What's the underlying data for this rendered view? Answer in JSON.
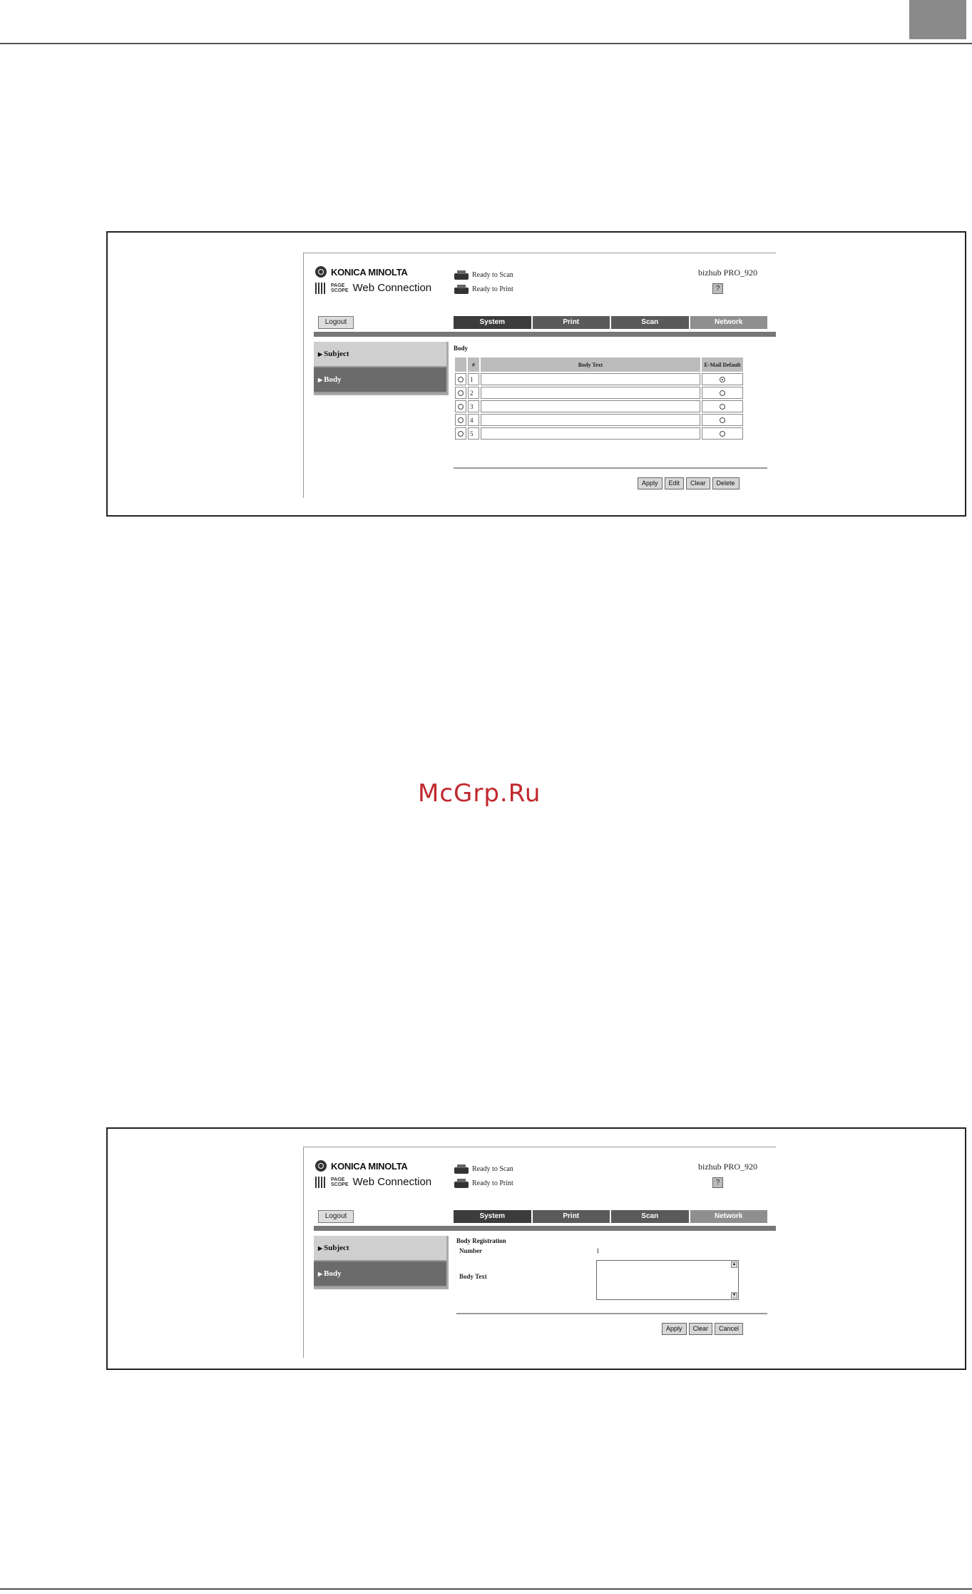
{
  "watermark": "McGrp.Ru",
  "screen1": {
    "brand": {
      "maker": "KONICA MINOLTA",
      "page_scope": "PAGE\nSCOPE",
      "product": "Web Connection"
    },
    "status": {
      "scan": "Ready to Scan",
      "print": "Ready to Print"
    },
    "device_name": "bizhub PRO_920",
    "help_icon": "help-icon",
    "logout_label": "Logout",
    "tabs": [
      "System",
      "Print",
      "Scan",
      "Network"
    ],
    "menu": {
      "subject": "Subject",
      "body": "Body"
    },
    "section_title": "Body",
    "table": {
      "headers": {
        "num": "#",
        "text": "Body Text",
        "default": "E-Mail Default"
      },
      "rows": [
        {
          "num": "1",
          "text": "",
          "default_checked": true
        },
        {
          "num": "2",
          "text": "",
          "default_checked": false
        },
        {
          "num": "3",
          "text": "",
          "default_checked": false
        },
        {
          "num": "4",
          "text": "",
          "default_checked": false
        },
        {
          "num": "5",
          "text": "",
          "default_checked": false
        }
      ]
    },
    "buttons": {
      "apply": "Apply",
      "edit": "Edit",
      "clear": "Clear",
      "delete": "Delete"
    }
  },
  "screen2": {
    "brand": {
      "maker": "KONICA MINOLTA",
      "page_scope": "PAGE\nSCOPE",
      "product": "Web Connection"
    },
    "status": {
      "scan": "Ready to Scan",
      "print": "Ready to Print"
    },
    "device_name": "bizhub PRO_920",
    "logout_label": "Logout",
    "tabs": [
      "System",
      "Print",
      "Scan",
      "Network"
    ],
    "menu": {
      "subject": "Subject",
      "body": "Body"
    },
    "section_title": "Body Registration",
    "number_label": "Number",
    "number_value": "1",
    "body_text_label": "Body Text",
    "body_text_value": "",
    "buttons": {
      "apply": "Apply",
      "clear": "Clear",
      "cancel": "Cancel"
    }
  }
}
